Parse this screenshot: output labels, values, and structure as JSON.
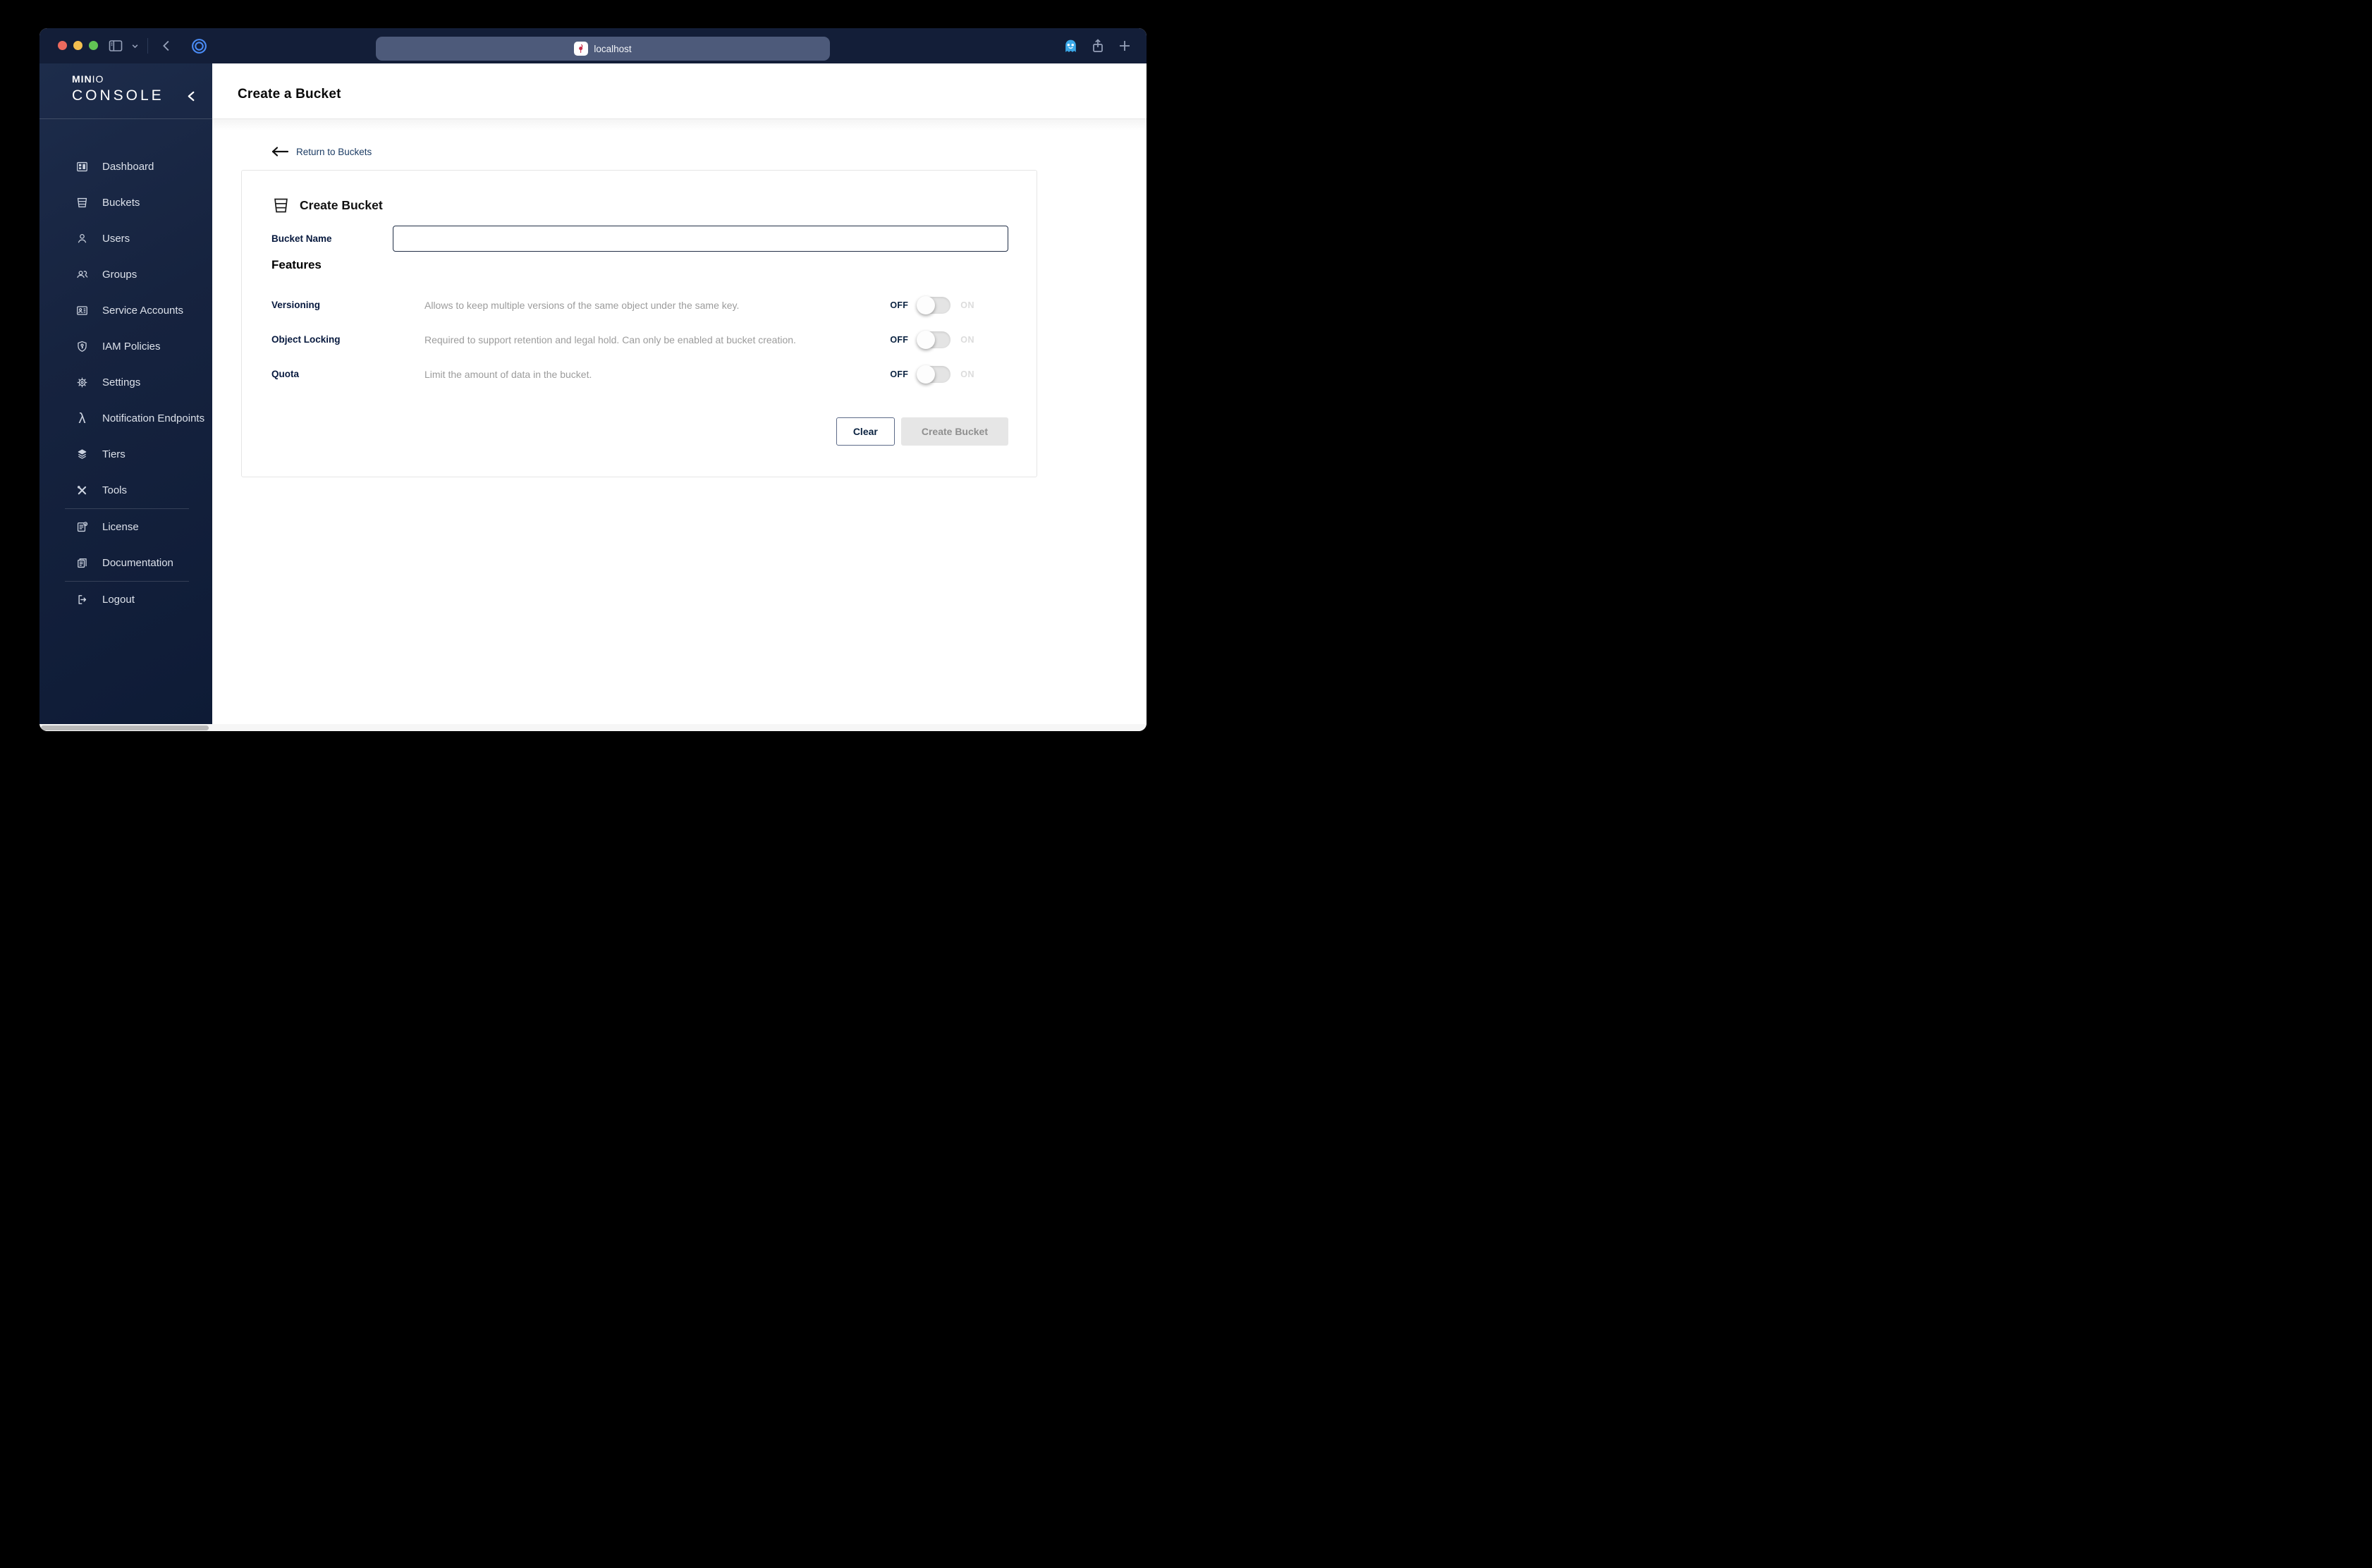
{
  "browser": {
    "address": "localhost"
  },
  "sidebar": {
    "logo": {
      "brand_bold": "MIN",
      "brand_light": "IO",
      "product": "CONSOLE"
    },
    "items": [
      {
        "label": "Dashboard"
      },
      {
        "label": "Buckets"
      },
      {
        "label": "Users"
      },
      {
        "label": "Groups"
      },
      {
        "label": "Service Accounts"
      },
      {
        "label": "IAM Policies"
      },
      {
        "label": "Settings"
      },
      {
        "label": "Notification Endpoints"
      },
      {
        "label": "Tiers"
      },
      {
        "label": "Tools"
      },
      {
        "label": "License"
      },
      {
        "label": "Documentation"
      },
      {
        "label": "Logout"
      }
    ]
  },
  "header": {
    "title": "Create a Bucket"
  },
  "main": {
    "back_link": "Return to Buckets",
    "card": {
      "title": "Create Bucket",
      "bucket_name_label": "Bucket Name",
      "bucket_name_value": "",
      "features_heading": "Features",
      "features": [
        {
          "label": "Versioning",
          "description": "Allows to keep multiple versions of the same object under the same key.",
          "state": "OFF"
        },
        {
          "label": "Object Locking",
          "description": "Required to support retention and legal hold. Can only be enabled at bucket creation.",
          "state": "OFF"
        },
        {
          "label": "Quota",
          "description": "Limit the amount of data in the bucket.",
          "state": "OFF"
        }
      ],
      "toggle": {
        "off": "OFF",
        "on": "ON"
      },
      "clear_label": "Clear",
      "create_label": "Create Bucket"
    }
  },
  "colors": {
    "titlebar": "#131e38",
    "sidebar_top": "#1d2c4b",
    "sidebar_bottom": "#0e1b36",
    "urlbar": "#4d5a7a",
    "label_navy": "#07193e",
    "link_navy": "#1c3c64",
    "desc_gray": "#9c9c9c",
    "disabled_bg": "#e6e6e6"
  }
}
